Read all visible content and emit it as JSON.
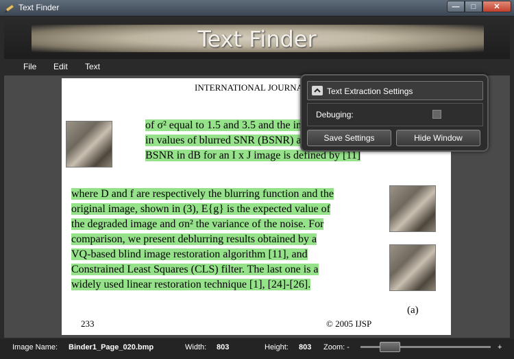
{
  "window": {
    "title": "Text Finder",
    "min_glyph": "—",
    "max_glyph": "□",
    "close_glyph": "✕"
  },
  "banner": {
    "title": "Text Finder"
  },
  "menu": [
    "File",
    "Edit",
    "Text"
  ],
  "document": {
    "header": "INTERNATIONAL JOURNAL OF SIGNAL PROCESSING",
    "para1_lines": [
      "of σ² equal to 1.5 and 3.5 and the improvement resulting",
      "in values of blurred SNR (BSNR) are listed in Table",
      "BSNR in dB for an I x J image is defined by [11]"
    ],
    "para2_lines": [
      "where D and f are respectively the blurring function and the",
      "original image, shown in (3), E{g} is the expected value of",
      "the degraded image and σn² the variance of the noise. For",
      "comparison, we present deblurring results obtained by a",
      "VQ-based blind image restoration algorithm [11], and",
      "Constrained Least Squares (CLS) filter. The last one is a",
      "widely used linear restoration technique [1], [24]-[26]."
    ],
    "caption": "(a)",
    "page_number": "233",
    "copyright": "© 2005 IJSP"
  },
  "settings_popup": {
    "header": "Text Extraction Settings",
    "debug_label": "Debuging:",
    "debug_checked": false,
    "save_label": "Save Settings",
    "hide_label": "Hide Window"
  },
  "status": {
    "image_name_label": "Image Name:",
    "image_name": "Binder1_Page_020.bmp",
    "width_label": "Width:",
    "width": "803",
    "height_label": "Height:",
    "height": "803",
    "zoom_label": "Zoom: -",
    "zoom_plus": "+",
    "zoom_fraction": 0.2
  },
  "colors": {
    "highlight": "#96e28a",
    "chrome_dark": "#2a2a2a"
  }
}
